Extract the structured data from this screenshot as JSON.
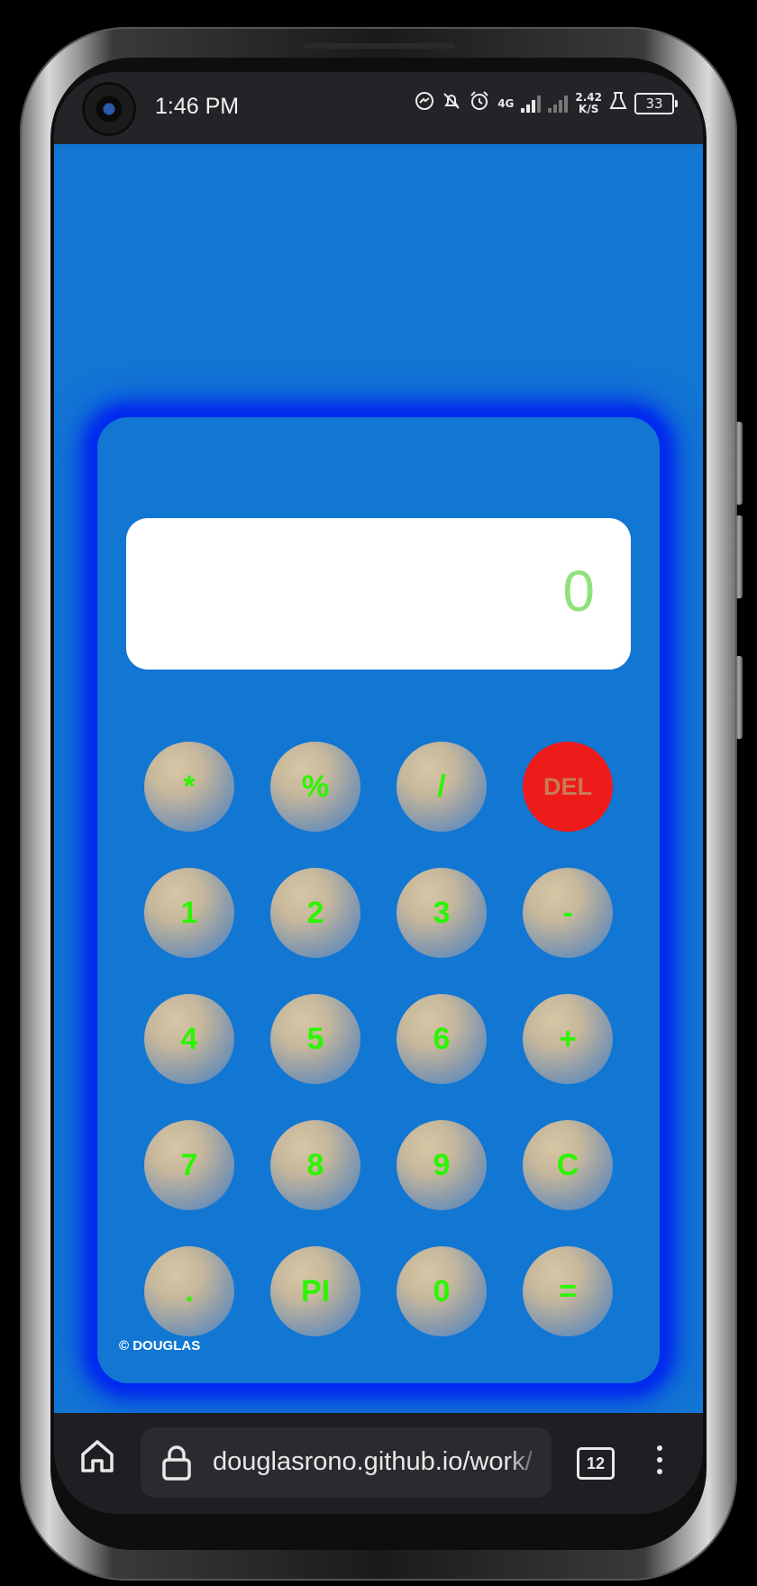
{
  "status_bar": {
    "time": "1:46 PM",
    "network_type": "4G",
    "speed_value": "2.42",
    "speed_unit": "K/S",
    "battery": "33"
  },
  "calculator": {
    "display_value": "0",
    "keys": [
      [
        "*",
        "%",
        "/",
        "DEL"
      ],
      [
        "1",
        "2",
        "3",
        "-"
      ],
      [
        "4",
        "5",
        "6",
        "+"
      ],
      [
        "7",
        "8",
        "9",
        "C"
      ],
      [
        ".",
        "PI",
        "0",
        "="
      ]
    ],
    "copyright": "© DOUGLAS"
  },
  "browser": {
    "url": "douglasrono.github.io/work/",
    "tab_count": "12"
  },
  "colors": {
    "page_background": "#1276d3",
    "glow": "#0028f0",
    "key_text": "#2cf500",
    "delete_key": "#ee1b1b",
    "display_text": "#8fe27b"
  },
  "icons": [
    "camera",
    "messenger-icon",
    "mute-notification-icon",
    "alarm-icon",
    "signal-icon",
    "lab-icon",
    "battery-icon",
    "home-icon",
    "lock-icon",
    "more-vert-icon"
  ]
}
